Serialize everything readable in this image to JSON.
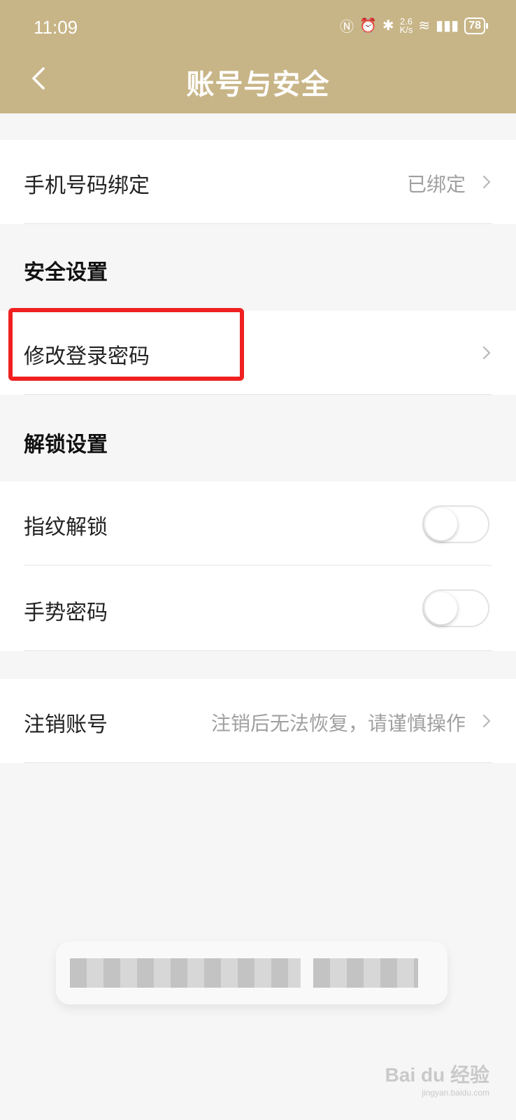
{
  "status_bar": {
    "time": "11:09",
    "net_speed": "2.6\nK/s",
    "battery": "78"
  },
  "header": {
    "title": "账号与安全"
  },
  "rows": {
    "phone": {
      "label": "手机号码绑定",
      "value": "已绑定"
    },
    "security_section": "安全设置",
    "change_password": {
      "label": "修改登录密码"
    },
    "unlock_section": "解锁设置",
    "fingerprint": {
      "label": "指纹解锁",
      "toggle_on": false
    },
    "gesture": {
      "label": "手势密码",
      "toggle_on": false
    },
    "cancel_account": {
      "label": "注销账号",
      "value": "注销后无法恢复，请谨慎操作"
    }
  },
  "watermark": {
    "brand": "Bai du 经验",
    "url": "jingyan.baidu.com"
  },
  "colors": {
    "header_bg": "#c8b587",
    "highlight": "#f02020",
    "value_text": "#a0a0a0"
  }
}
